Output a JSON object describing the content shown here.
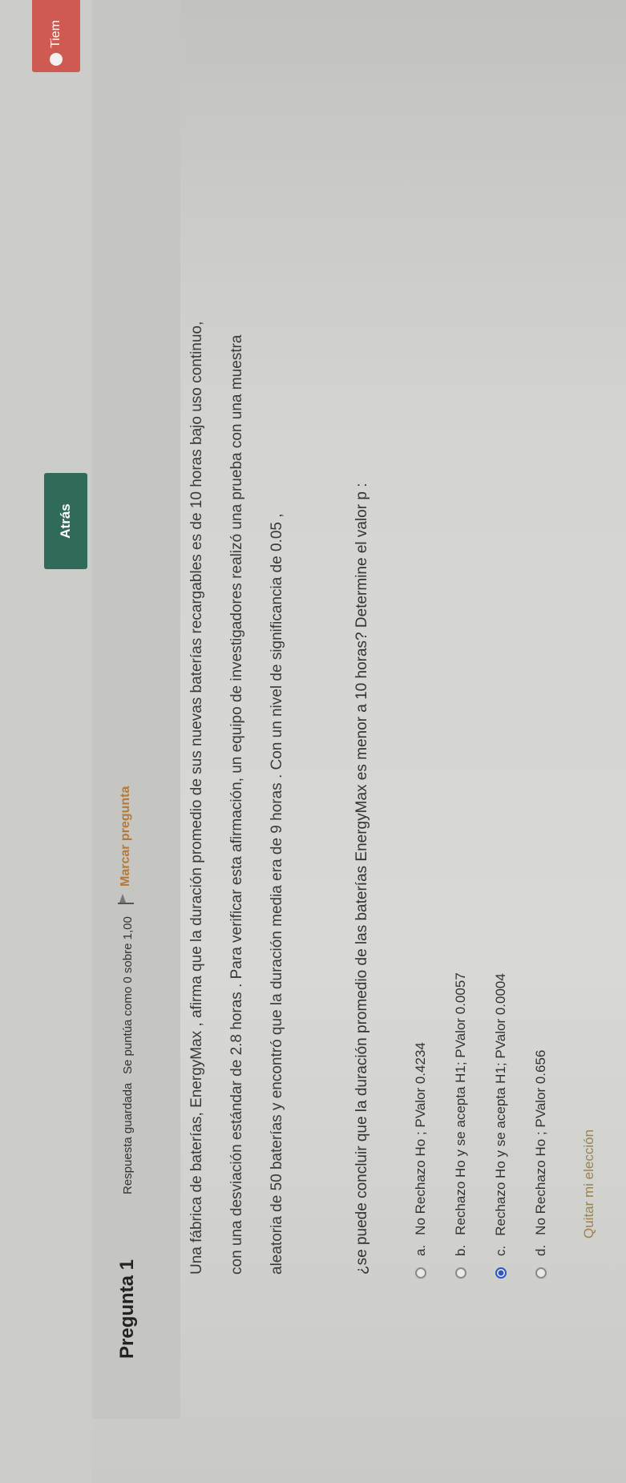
{
  "nav": {
    "back_label": "Atrás",
    "timer_label": "Tiem"
  },
  "question": {
    "title": "Pregunta 1",
    "state": "Respuesta guardada",
    "grade": "Se puntúa como 0 sobre 1,00",
    "flag_label": "Marcar pregunta",
    "text_lines": [
      "Una fábrica de baterías, EnergyMax , afirma que la duración promedio de sus nuevas baterías recargables es de 10 horas bajo uso continuo,",
      "con una desviación estándar de 2.8 horas . Para verificar esta afirmación, un equipo de investigadores realizó una prueba con una muestra",
      "aleatoria de 50 baterías y encontró que la duración media era de 9 horas . Con un nivel de significancia de 0.05 ,",
      "¿se puede concluir que la duración promedio de las baterías EnergyMax es menor a 10 horas? Determine el valor p :"
    ],
    "options": [
      {
        "letter": "a.",
        "text": "No Rechazo Ho ; PValor 0.4234",
        "selected": false
      },
      {
        "letter": "b.",
        "text": "Rechazo Ho y se acepta H1; PValor 0.0057",
        "selected": false
      },
      {
        "letter": "c.",
        "text": "Rechazo Ho y se acepta H1; PValor 0.0004",
        "selected": true
      },
      {
        "letter": "d.",
        "text": "No Rechazo Ho ; PValor 0.656",
        "selected": false
      }
    ],
    "clear_label": "Quitar mi elección"
  }
}
